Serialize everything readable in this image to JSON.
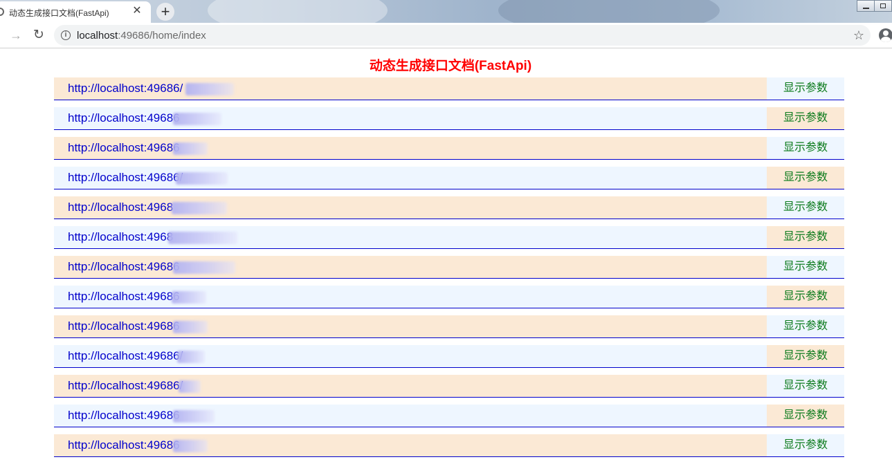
{
  "browser": {
    "tab_title": "动态生成接口文档(FastApi)",
    "tab_close": "✕",
    "new_tab": "+",
    "address": {
      "host": "localhost",
      "rest": ":49686/home/index"
    },
    "icons": {
      "forward": "forward-arrow-icon",
      "reload": "reload-icon",
      "info": "info-icon",
      "star": "star-icon",
      "profile": "profile-icon"
    }
  },
  "page": {
    "title": "动态生成接口文档(FastApi)",
    "show_params_label": "显示参数",
    "apis": [
      {
        "url": "http://localhost:49686/"
      },
      {
        "url": "http://localhost:49686"
      },
      {
        "url": "http://localhost:49686"
      },
      {
        "url": "http://localhost:49686/"
      },
      {
        "url": "http://localhost:4968"
      },
      {
        "url": "http://localhost:4968"
      },
      {
        "url": "http://localhost:49686"
      },
      {
        "url": "http://localhost:49686"
      },
      {
        "url": "http://localhost:49686"
      },
      {
        "url": "http://localhost:49686/"
      },
      {
        "url": "http://localhost:49686/"
      },
      {
        "url": "http://localhost:49686"
      },
      {
        "url": "http://localhost:49686"
      }
    ]
  },
  "colors": {
    "title": "#ff0000",
    "link": "#0000cc",
    "param": "#0a7a1a",
    "row_a": "#fbe9d5",
    "row_b": "#eef6ff"
  }
}
